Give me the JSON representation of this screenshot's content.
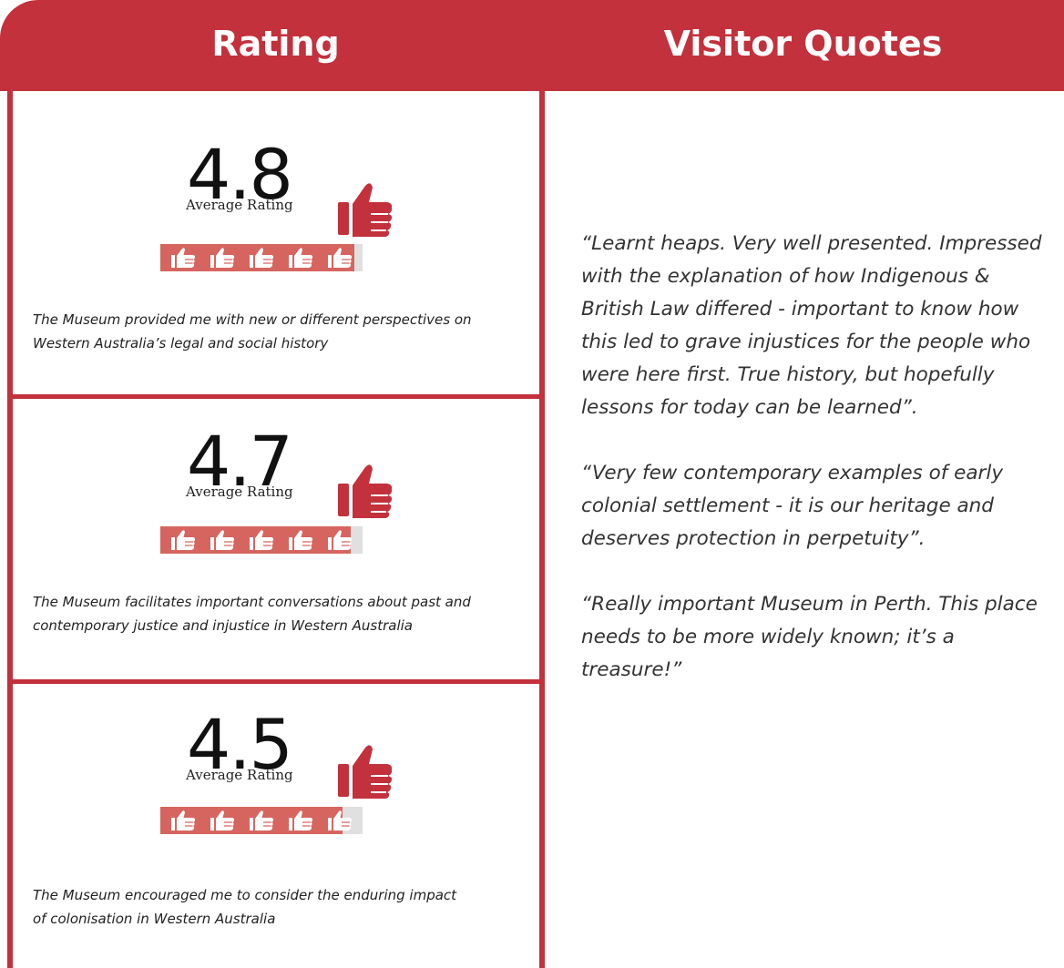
{
  "header": {
    "left_title": "Rating",
    "right_title": "Visitor Quotes"
  },
  "colors": {
    "brand_red": "#c2313c",
    "bar_red": "#d66560",
    "bar_track": "#e0e0e0"
  },
  "ratings": [
    {
      "score": "4.8",
      "label": "Average Rating",
      "fill_fraction": 0.96,
      "icon_count": 5,
      "description": "The Museum provided me with new or different perspectives on Western Australia’s legal and social history"
    },
    {
      "score": "4.7",
      "label": "Average Rating",
      "fill_fraction": 0.94,
      "icon_count": 5,
      "description": "The Museum facilitates important conversations about past and contemporary justice and injustice in Western Australia"
    },
    {
      "score": "4.5",
      "label": "Average Rating",
      "fill_fraction": 0.9,
      "icon_count": 5,
      "description": "The Museum encouraged me to consider the enduring impact of colonisation in Western Australia"
    }
  ],
  "quotes": [
    "“Learnt heaps. Very well presented. Impressed with the explanation of how Indigenous & British Law differed - important to know how this led to grave injustices for the people who were here first. True history, but hopefully lessons for today can be learned”.",
    "“Very few contemporary examples of early colonial settlement - it is our heritage and deserves protection in perpetuity”.",
    "“Really important Museum in Perth. This place needs to be more widely known; it’s a treasure!”"
  ],
  "icons": {
    "big": "thumbs-up-icon",
    "small": "thumbs-up-icon"
  }
}
